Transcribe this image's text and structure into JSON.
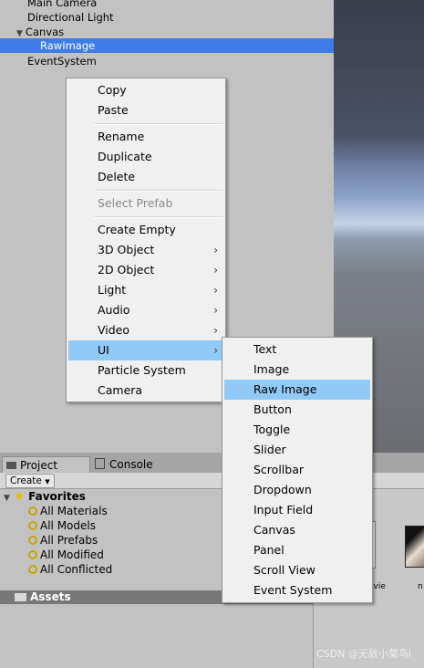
{
  "hierarchy": {
    "rows": [
      "Main Camera",
      "Directional Light",
      "Canvas",
      "RawImage",
      "EventSystem"
    ]
  },
  "context_menu": {
    "items": [
      {
        "label": "Copy"
      },
      {
        "label": "Paste"
      },
      {
        "label": "Rename"
      },
      {
        "label": "Duplicate"
      },
      {
        "label": "Delete"
      },
      {
        "label": "Select Prefab",
        "disabled": true
      },
      {
        "label": "Create Empty"
      },
      {
        "label": "3D Object",
        "submenu": true
      },
      {
        "label": "2D Object",
        "submenu": true
      },
      {
        "label": "Light",
        "submenu": true
      },
      {
        "label": "Audio",
        "submenu": true
      },
      {
        "label": "Video",
        "submenu": true
      },
      {
        "label": "UI",
        "submenu": true,
        "highlighted": true
      },
      {
        "label": "Particle System"
      },
      {
        "label": "Camera"
      }
    ]
  },
  "ui_submenu": {
    "items": [
      "Text",
      "Image",
      "Raw Image",
      "Button",
      "Toggle",
      "Slider",
      "Scrollbar",
      "Dropdown",
      "Input Field",
      "Canvas",
      "Panel",
      "Scroll View",
      "Event System"
    ],
    "highlighted": "Raw Image"
  },
  "tabs": {
    "project": "Project",
    "console": "Console"
  },
  "toolbar": {
    "create_label": "Create"
  },
  "favorites": {
    "title": "Favorites",
    "items": [
      "All Materials",
      "All Models",
      "All Prefabs",
      "All Modified",
      "All Conflicted"
    ]
  },
  "assets": {
    "label": "Assets"
  },
  "right_pane": {
    "ovie": "ovie",
    "n": "n"
  },
  "watermark": "CSDN @无敌小菜鸟i",
  "colors": {
    "selection": "#3e7de7",
    "menu_highlight": "#91c9f7",
    "menu_bg": "#f0f0f0"
  }
}
